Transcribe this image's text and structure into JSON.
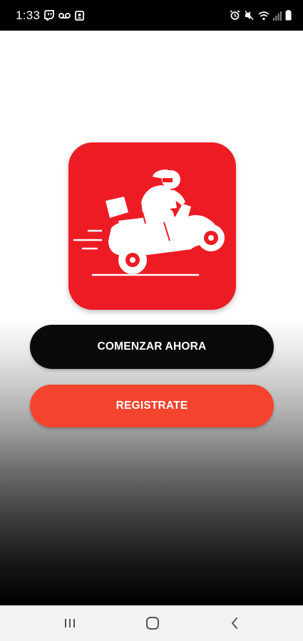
{
  "status_bar": {
    "time": "1:33",
    "left_icons": [
      "twitch-icon",
      "voicemail-icon",
      "photo-icon"
    ],
    "right_icons": [
      "alarm-icon",
      "mute-icon",
      "wifi-icon",
      "signal-icon",
      "battery-icon"
    ]
  },
  "app": {
    "logo_icon": "delivery-scooter-icon",
    "brand_color": "#ed1c24",
    "start_label": "COMENZAR AHORA",
    "register_label": "REGISTRATE",
    "start_color": "#0a0a0a",
    "register_color": "#f4442e"
  },
  "nav_bar": {
    "buttons": [
      "recent-apps-icon",
      "home-icon",
      "back-icon"
    ]
  }
}
